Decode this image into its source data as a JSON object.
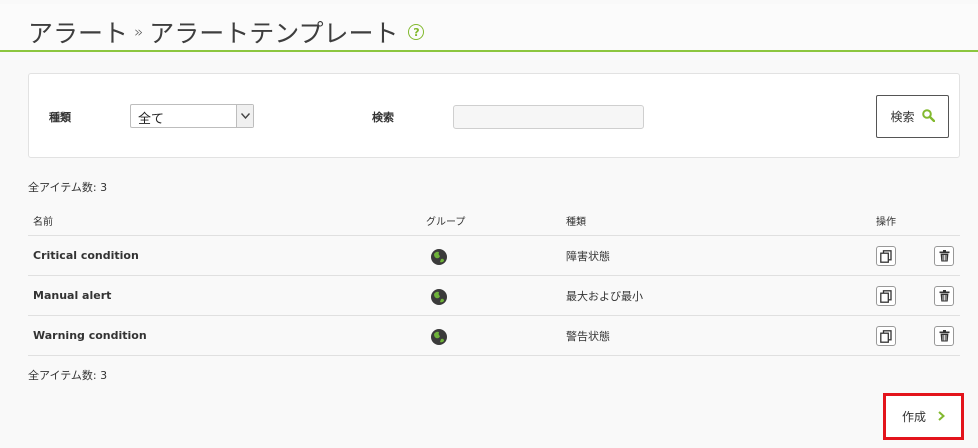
{
  "header": {
    "breadcrumb_root": "アラート",
    "breadcrumb_sep": "»",
    "breadcrumb_current": "アラートテンプレート",
    "help_glyph": "?"
  },
  "filters": {
    "type_label": "種類",
    "type_selected": "全て",
    "search_label": "検索",
    "search_value": "",
    "search_button": "検索"
  },
  "totals": {
    "top": "全アイテム数: 3",
    "bottom": "全アイテム数: 3"
  },
  "table": {
    "headers": {
      "name": "名前",
      "group": "グループ",
      "type": "種類",
      "actions": "操作"
    },
    "rows": [
      {
        "name": "Critical condition",
        "group_icon": "globe-icon",
        "type": "障害状態"
      },
      {
        "name": "Manual alert",
        "group_icon": "globe-icon",
        "type": "最大および最小"
      },
      {
        "name": "Warning condition",
        "group_icon": "globe-icon",
        "type": "警告状態"
      }
    ]
  },
  "actions": {
    "create_label": "作成"
  },
  "colors": {
    "accent": "#82b92e",
    "header_line": "#8cc63f",
    "highlight": "#e3141c"
  }
}
